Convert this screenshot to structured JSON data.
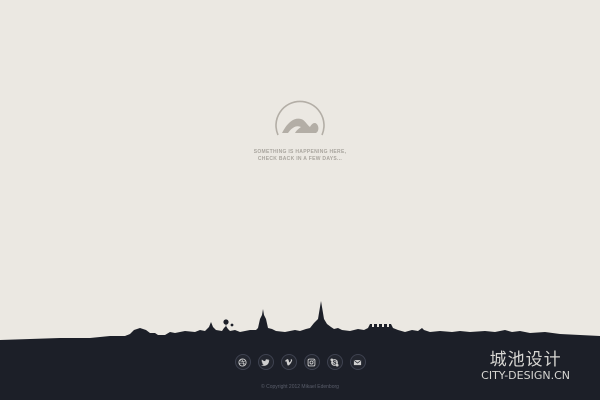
{
  "tagline": {
    "line1": "SOMETHING IS HAPPENING HERE,",
    "line2": "CHECK BACK IN A FEW DAYS..."
  },
  "social": [
    {
      "icon": "dribbble-icon"
    },
    {
      "icon": "twitter-icon"
    },
    {
      "icon": "vimeo-icon"
    },
    {
      "icon": "instagram-icon"
    },
    {
      "icon": "skype-icon"
    },
    {
      "icon": "mail-icon"
    }
  ],
  "footer": {
    "copyright": "© Copyright 2012 Mikael Edenborg"
  },
  "watermark": {
    "chinese": "城池设计",
    "english": "CITY-DESIGN.CN"
  },
  "colors": {
    "background": "#ebe8e2",
    "footer": "#1c1f28",
    "logo": "#b3aea6",
    "text_muted": "#a9a59e"
  }
}
